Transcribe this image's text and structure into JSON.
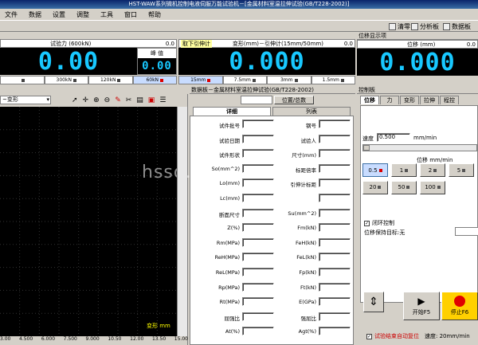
{
  "window": {
    "title": "HST-WAW系列微机控制电液伺服万能试验机－[金属材料室温拉伸试验(GB/T228-2002)]"
  },
  "menu": [
    "文件",
    "数据",
    "设置",
    "调整",
    "工具",
    "窗口",
    "帮助"
  ],
  "toolbar": {
    "clear": "清零",
    "analysis": "分析板",
    "data": "数据板"
  },
  "force_panel": {
    "header": "",
    "label": "试验力 (600kN)",
    "offset": "0.0",
    "value": "0.00",
    "peak_label": "峰 值",
    "peak_value": "0.00",
    "ranges": [
      {
        "label": "",
        "selected": false
      },
      {
        "label": "300kN",
        "selected": false
      },
      {
        "label": "120kN",
        "selected": false
      },
      {
        "label": "60kN",
        "selected": true
      }
    ]
  },
  "extens_panel": {
    "remove_label": "取下引伸计",
    "label": "变形(mm)－引伸计(15mm/50mm)",
    "offset": "0.0",
    "value": "0.000",
    "ranges": [
      {
        "label": "15mm",
        "selected": true
      },
      {
        "label": "7.5mm",
        "selected": false
      },
      {
        "label": "3mm",
        "selected": false
      },
      {
        "label": "1.5mm",
        "selected": false
      }
    ]
  },
  "disp_panel": {
    "header": "位移显示项",
    "label": "位移 (mm)",
    "offset": "0.0",
    "value": "0.000"
  },
  "chart": {
    "selector": "~变形",
    "xlabel": "变形 mm",
    "xticks": [
      "3.00",
      "4.500",
      "6.000",
      "7.500",
      "9.000",
      "10.50",
      "12.00",
      "13.50",
      "15.00"
    ]
  },
  "data_panel": {
    "header": "数据板－金属材料室温拉伸试验(GB/T228-2002)",
    "position_btn": "位置/总数",
    "tabs": [
      "详细",
      "列表"
    ],
    "left_fields": [
      "试件批号",
      "试验日期",
      "试件形状",
      "So(mm^2)",
      "Lo(mm)",
      "Lc(mm)",
      "断面尺寸",
      "Z(%)",
      "Rm(MPa)",
      "ReH(MPa)",
      "ReL(MPa)",
      "Rp(MPa)",
      "Rt(MPa)",
      "屈强比",
      "At(%)"
    ],
    "right_fields": [
      "钢号",
      "试验人",
      "尺寸(mm)",
      "标距倍率",
      "引伸计标距",
      "",
      "Su(mm^2)",
      "Fm(kN)",
      "FeH(kN)",
      "FeL(kN)",
      "Fp(kN)",
      "Ft(kN)",
      "E(GPa)",
      "强屈比",
      "Agt(%)"
    ]
  },
  "control_panel": {
    "header": "控制板",
    "tabs": [
      "位移",
      "力",
      "变形",
      "拉伸",
      "程控"
    ],
    "speed_label": "速度",
    "speed_value": "0.500",
    "speed_unit": "mm/min",
    "speed_group_label": "位移 mm/min",
    "speed_buttons": [
      {
        "label": "0.5",
        "selected": true
      },
      {
        "label": "1",
        "selected": false
      },
      {
        "label": "2",
        "selected": false
      },
      {
        "label": "5",
        "selected": false
      },
      {
        "label": "20",
        "selected": false
      },
      {
        "label": "50",
        "selected": false
      },
      {
        "label": "100",
        "selected": false
      }
    ],
    "closed_loop_label": "闭环控制",
    "hold_target_label": "位移保持目标:无",
    "start_label": "开始F5",
    "stop_label": "停止F6",
    "auto_reset_label": "试验结束自动复位",
    "speed_status": "速度: 20mm/min"
  },
  "watermark": "hssd.en.alibaba.com",
  "colors": {
    "lcd_text": "#18c8ff",
    "lcd_bg": "#000000",
    "stop_red": "#e00000"
  }
}
